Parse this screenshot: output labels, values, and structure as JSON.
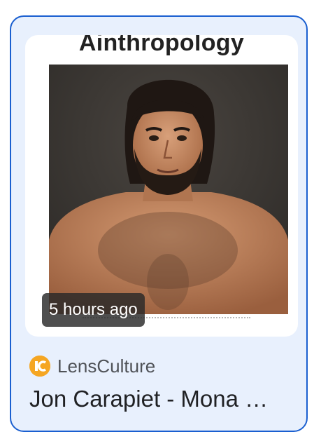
{
  "card": {
    "thumbnail": {
      "heading": "Ainthropology",
      "alt": "photo of a bearded man with long dark hair",
      "timestamp": "5 hours ago"
    },
    "source": {
      "name": "LensCulture",
      "logo_icon": "lensculture-logo-icon",
      "logo_color": "#f5a623"
    },
    "title": "Jon Carapiet - Mona …"
  },
  "colors": {
    "card_border": "#1a5fd0",
    "card_background": "#e8f0fd",
    "title_text": "#202124",
    "source_text": "#4f5257"
  }
}
